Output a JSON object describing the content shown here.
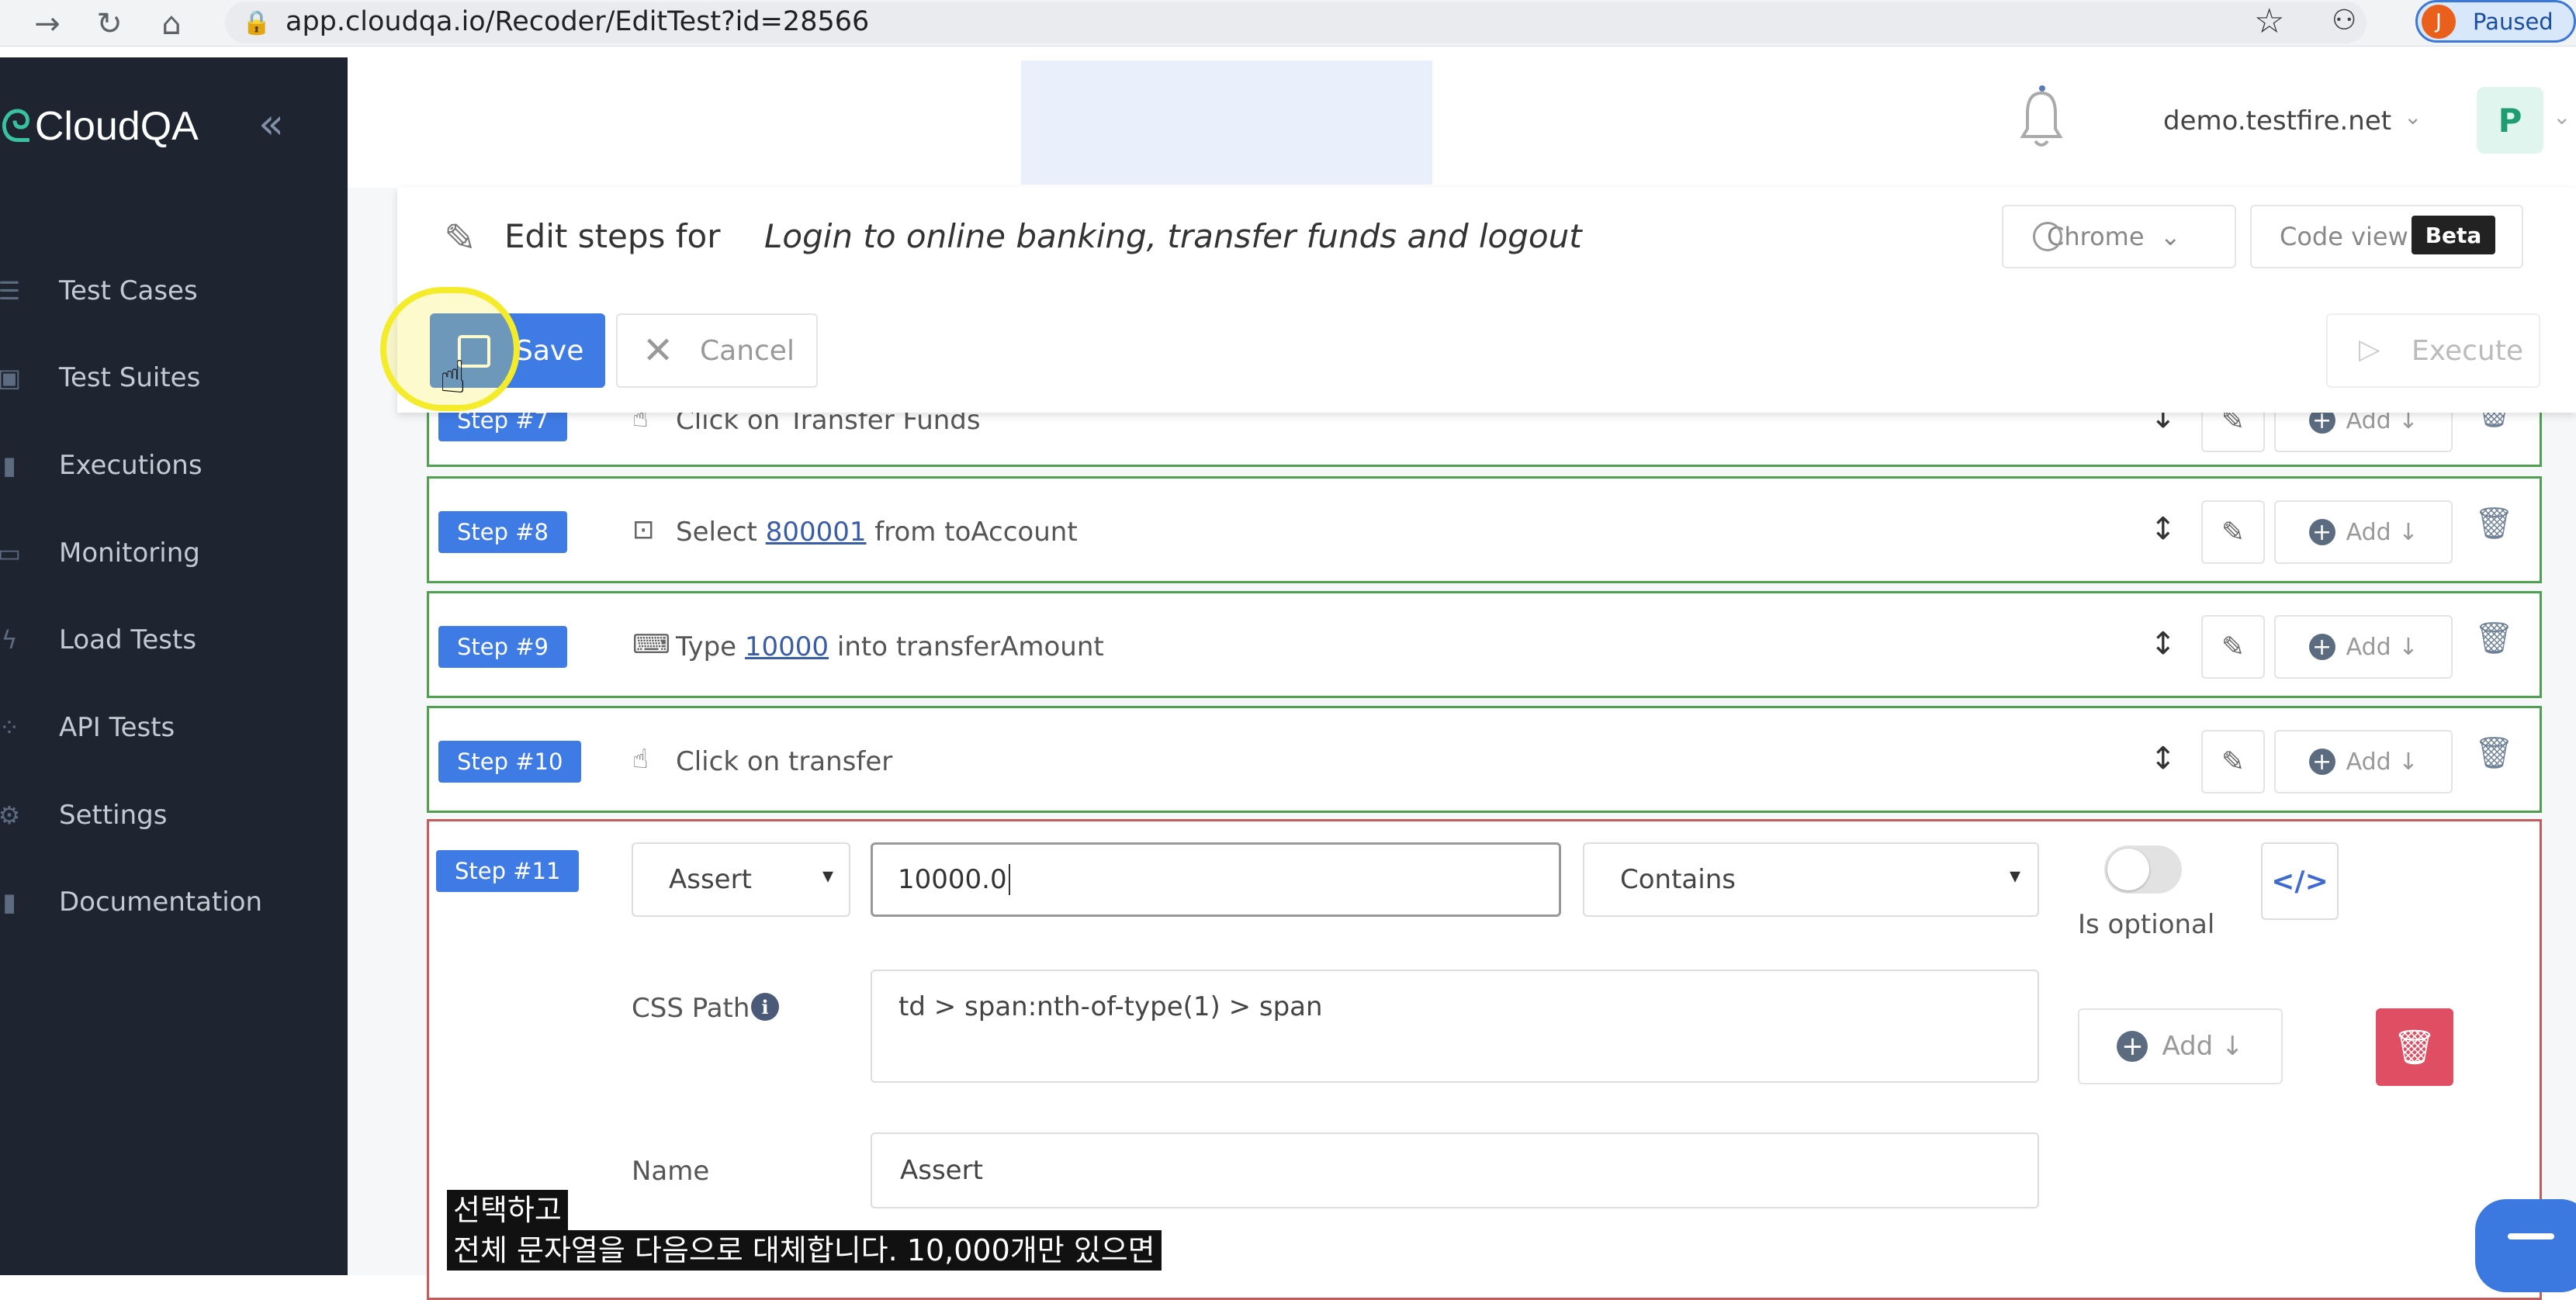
{
  "browser": {
    "url": "app.cloudqa.io/Recoder/EditTest?id=28566",
    "profile_initial": "J",
    "paused_label": "Paused"
  },
  "sidebar": {
    "logo_text": "CloudQA",
    "items": [
      {
        "label": "Test Cases",
        "icon": "list-icon"
      },
      {
        "label": "Test Suites",
        "icon": "suites-icon"
      },
      {
        "label": "Executions",
        "icon": "bar-chart-icon"
      },
      {
        "label": "Monitoring",
        "icon": "monitor-icon"
      },
      {
        "label": "Load Tests",
        "icon": "bolt-icon"
      },
      {
        "label": "API Tests",
        "icon": "api-icon"
      },
      {
        "label": "Settings",
        "icon": "gear-icon"
      },
      {
        "label": "Documentation",
        "icon": "book-icon"
      }
    ]
  },
  "header": {
    "org": "demo.testfire.net",
    "user_initial": "P"
  },
  "editor": {
    "edit_label": "Edit steps for",
    "test_name": "Login to online banking, transfer funds and logout",
    "browser_select": "Chrome",
    "code_view": "Code view",
    "beta": "Beta",
    "save": "Save",
    "cancel": "Cancel",
    "execute": "Execute"
  },
  "steps": [
    {
      "badge": "Step #7",
      "text": "Click on Transfer Funds"
    },
    {
      "badge": "Step #8",
      "pre": "Select ",
      "link": "800001",
      "post": " from toAccount"
    },
    {
      "badge": "Step #9",
      "pre": "Type ",
      "link": "10000",
      "post": " into transferAmount"
    },
    {
      "badge": "Step #10",
      "text": "Click on transfer"
    }
  ],
  "step_actions": {
    "add": "Add"
  },
  "step11": {
    "badge": "Step #11",
    "action": "Assert",
    "value": "10000.0",
    "condition": "Contains",
    "optional_label": "Is optional",
    "optional_on": false,
    "code_icon": "</>",
    "css_label": "CSS Path",
    "css_path": "td > span:nth-of-type(1) > span",
    "add": "Add",
    "name_label": "Name",
    "name_value": "Assert"
  },
  "subtitles": {
    "line1": "선택하고",
    "line2": "전체 문자열을 다음으로 대체합니다. 10,000개만 있으면"
  }
}
